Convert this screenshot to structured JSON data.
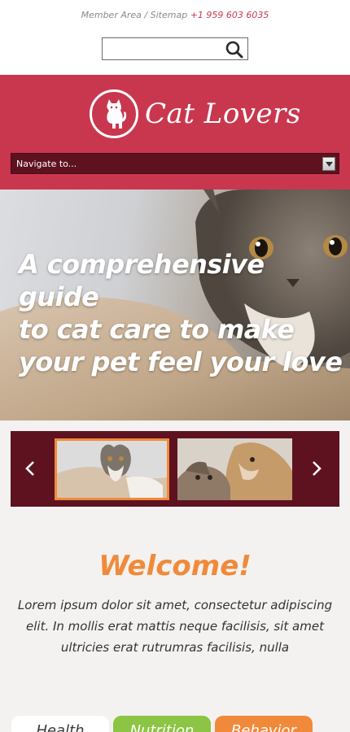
{
  "top_links": {
    "member_area": "Member Area",
    "separator": "/",
    "sitemap": "Sitemap",
    "phone": "+1 959 603 6035"
  },
  "search": {
    "placeholder": "",
    "value": "",
    "icon": "search-icon"
  },
  "header": {
    "logo_text": "Cat Lovers",
    "logo_icon": "cat-icon",
    "background_color": "#c9374e"
  },
  "nav": {
    "selected_label": "Navigate to...",
    "arrow_icon": "chevron-down-icon"
  },
  "hero": {
    "line1": "A comprehensive guide",
    "line2": "to cat care to make",
    "line3": "your pet feel your love"
  },
  "carousel": {
    "prev_icon": "chevron-left-icon",
    "next_icon": "chevron-right-icon",
    "thumbs": [
      {
        "name": "cat-thumbnail",
        "active": true
      },
      {
        "name": "kittens-thumbnail",
        "active": false
      }
    ],
    "background_color": "#5e1220",
    "active_border_color": "#f08a3a"
  },
  "welcome": {
    "title": "Welcome!",
    "body": "Lorem ipsum dolor sit amet, consectetur adipiscing elit. In mollis erat mattis neque facilisis, sit amet ultricies erat rutrumras facilisis, nulla"
  },
  "category_tabs": [
    {
      "label": "Health",
      "color": "#ffffff"
    },
    {
      "label": "Nutrition",
      "color": "#8cc443"
    },
    {
      "label": "Behavior",
      "color": "#f08a3a"
    }
  ]
}
